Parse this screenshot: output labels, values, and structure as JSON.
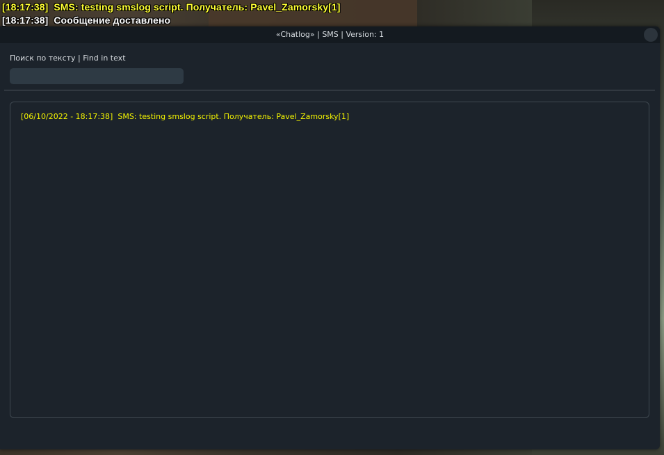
{
  "chat_overlay": {
    "lines": [
      "[18:17:38]  SMS: testing smslog script. Получатель: Pavel_Zamorsky[1]",
      "[18:17:38]  Сообщение доставлено"
    ],
    "colors": [
      "#ffff33",
      "#ffffff"
    ]
  },
  "window": {
    "title": "«Chatlog» | SMS | Version: 1",
    "close_icon": "circle-close-icon"
  },
  "search": {
    "label": "Поиск по тексту | Find in text",
    "value": "",
    "placeholder": ""
  },
  "log": {
    "entries": [
      "[06/10/2022 - 18:17:38]  SMS: testing smslog script. Получатель: Pavel_Zamorsky[1]"
    ],
    "entry_color": "#f4f400"
  },
  "theme": {
    "window_bg": "#1c232b",
    "titlebar_bg": "#141a20",
    "input_bg": "#2e3a44"
  }
}
